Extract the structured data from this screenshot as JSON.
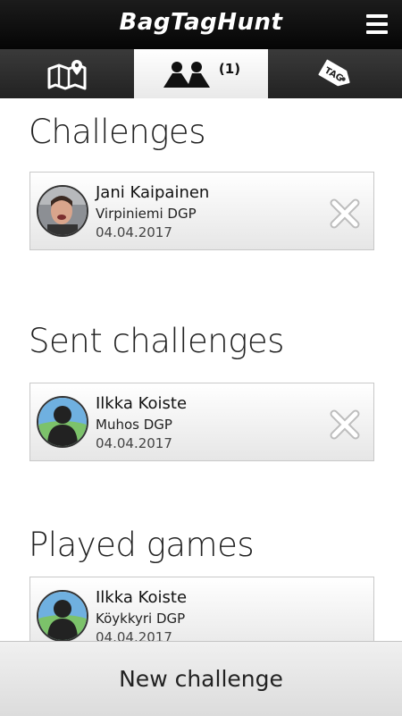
{
  "app": {
    "title": "BagTagHunt"
  },
  "tabs": {
    "map": {
      "icon": "map-icon"
    },
    "challenges": {
      "icon": "players-icon",
      "badge": "(1)"
    },
    "tags": {
      "icon": "tag-icon",
      "label": "TAG"
    }
  },
  "sections": {
    "challenges": {
      "title": "Challenges",
      "item": {
        "name": "Jani Kaipainen",
        "course": "Virpiniemi DGP",
        "date": "04.04.2017"
      }
    },
    "sent": {
      "title": "Sent challenges",
      "item": {
        "name": "Ilkka Koiste",
        "course": "Muhos DGP",
        "date": "04.04.2017"
      }
    },
    "played": {
      "title": "Played games",
      "item": {
        "name": "Ilkka Koiste",
        "course": "Köykkyri DGP",
        "date": "04.04.2017"
      }
    }
  },
  "footer": {
    "new_challenge_label": "New challenge"
  }
}
